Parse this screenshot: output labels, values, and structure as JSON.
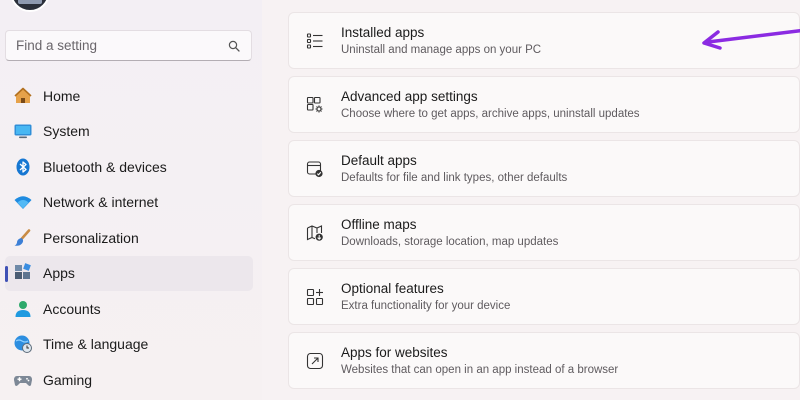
{
  "search": {
    "placeholder": "Find a setting"
  },
  "sidebar": {
    "items": [
      {
        "label": "Home",
        "icon": "home-icon"
      },
      {
        "label": "System",
        "icon": "monitor-icon"
      },
      {
        "label": "Bluetooth & devices",
        "icon": "bluetooth-icon"
      },
      {
        "label": "Network & internet",
        "icon": "wifi-icon"
      },
      {
        "label": "Personalization",
        "icon": "brush-icon"
      },
      {
        "label": "Apps",
        "icon": "apps-icon",
        "active": true
      },
      {
        "label": "Accounts",
        "icon": "person-icon"
      },
      {
        "label": "Time & language",
        "icon": "globe-clock-icon"
      },
      {
        "label": "Gaming",
        "icon": "gamepad-icon"
      }
    ]
  },
  "cards": [
    {
      "title": "Installed apps",
      "subtitle": "Uninstall and manage apps on your PC",
      "icon": "list-icon"
    },
    {
      "title": "Advanced app settings",
      "subtitle": "Choose where to get apps, archive apps, uninstall updates",
      "icon": "app-gear-icon"
    },
    {
      "title": "Default apps",
      "subtitle": "Defaults for file and link types, other defaults",
      "icon": "window-check-icon"
    },
    {
      "title": "Offline maps",
      "subtitle": "Downloads, storage location, map updates",
      "icon": "map-download-icon"
    },
    {
      "title": "Optional features",
      "subtitle": "Extra functionality for your device",
      "icon": "grid-plus-icon"
    },
    {
      "title": "Apps for websites",
      "subtitle": "Websites that can open in an app instead of a browser",
      "icon": "external-link-icon"
    }
  ],
  "colors": {
    "accent": "#3f51b5",
    "annotation_arrow": "#8b2be2"
  }
}
